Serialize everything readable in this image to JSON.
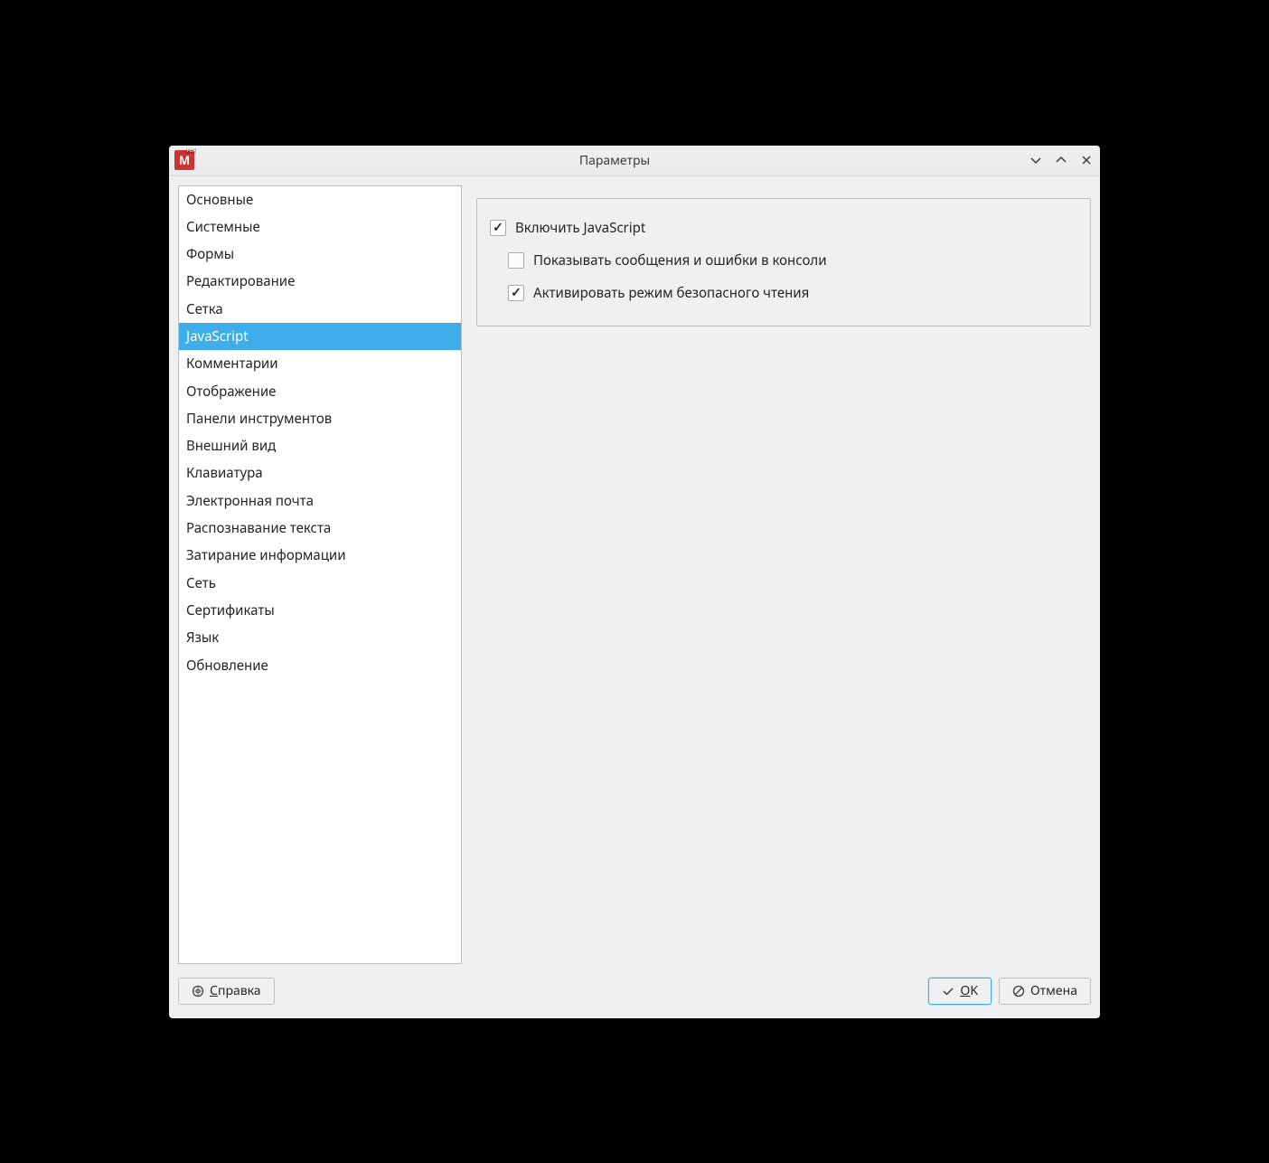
{
  "window": {
    "title": "Параметры"
  },
  "sidebar": {
    "items": [
      {
        "label": "Основные",
        "name": "sidebar-item-general"
      },
      {
        "label": "Системные",
        "name": "sidebar-item-system"
      },
      {
        "label": "Формы",
        "name": "sidebar-item-forms"
      },
      {
        "label": "Редактирование",
        "name": "sidebar-item-editing"
      },
      {
        "label": "Сетка",
        "name": "sidebar-item-grid"
      },
      {
        "label": "JavaScript",
        "name": "sidebar-item-javascript",
        "selected": true
      },
      {
        "label": "Комментарии",
        "name": "sidebar-item-comments"
      },
      {
        "label": "Отображение",
        "name": "sidebar-item-display"
      },
      {
        "label": "Панели инструментов",
        "name": "sidebar-item-toolbars"
      },
      {
        "label": "Внешний вид",
        "name": "sidebar-item-appearance"
      },
      {
        "label": "Клавиатура",
        "name": "sidebar-item-keyboard"
      },
      {
        "label": "Электронная почта",
        "name": "sidebar-item-email"
      },
      {
        "label": "Распознавание текста",
        "name": "sidebar-item-ocr"
      },
      {
        "label": "Затирание информации",
        "name": "sidebar-item-redaction"
      },
      {
        "label": "Сеть",
        "name": "sidebar-item-network"
      },
      {
        "label": "Сертификаты",
        "name": "sidebar-item-certificates"
      },
      {
        "label": "Язык",
        "name": "sidebar-item-language"
      },
      {
        "label": "Обновление",
        "name": "sidebar-item-update"
      }
    ]
  },
  "settings": {
    "enable_js": {
      "label": "Включить JavaScript",
      "checked": true
    },
    "show_console": {
      "label": "Показывать сообщения и ошибки в консоли",
      "checked": false
    },
    "safe_reading": {
      "label": "Активировать режим безопасного чтения",
      "checked": true
    }
  },
  "footer": {
    "help_label": "Справка",
    "ok_label": "OK",
    "cancel_label": "Отмена"
  }
}
